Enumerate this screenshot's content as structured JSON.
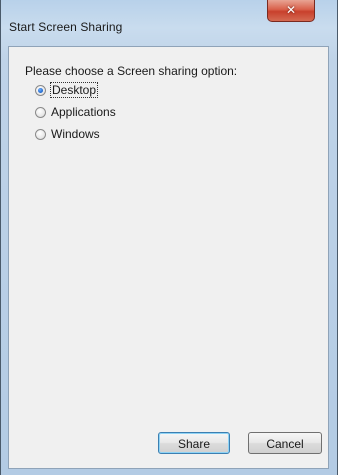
{
  "window": {
    "title": "Start Screen Sharing",
    "close_glyph": "✕"
  },
  "dialog": {
    "prompt": "Please choose a Screen sharing option:",
    "options": [
      {
        "label": "Desktop",
        "selected": true
      },
      {
        "label": "Applications",
        "selected": false
      },
      {
        "label": "Windows",
        "selected": false
      }
    ]
  },
  "buttons": {
    "share_label": "Share",
    "cancel_label": "Cancel"
  }
}
